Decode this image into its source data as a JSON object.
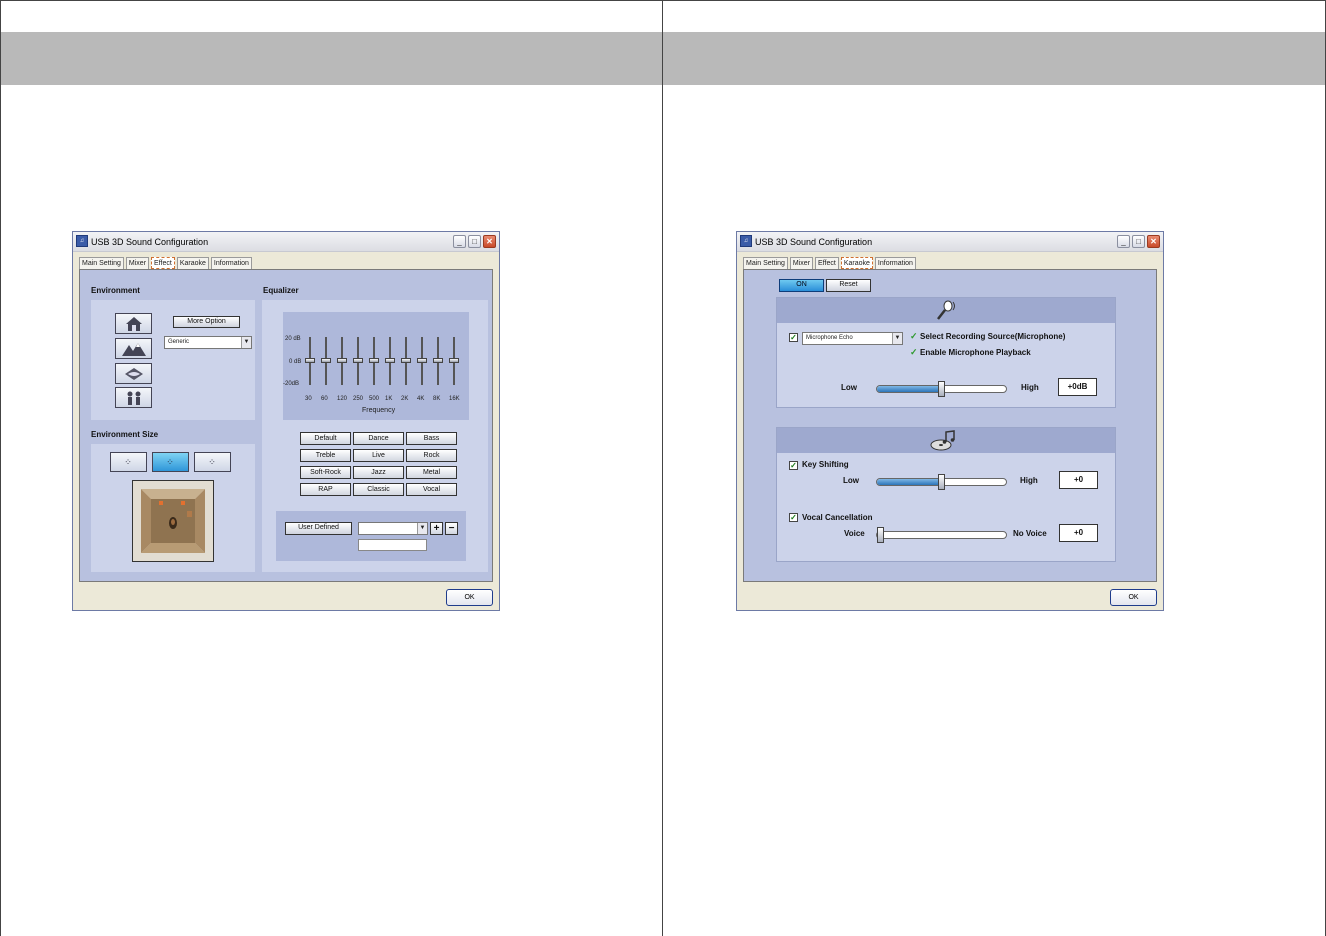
{
  "left_window": {
    "title": "USB 3D Sound Configuration",
    "tabs": [
      "Main Setting",
      "Mixer",
      "Effect",
      "Karaoke",
      "Information"
    ],
    "active_tab": "Effect",
    "environment": {
      "label": "Environment",
      "more_option": "More Option",
      "selected_preset": "Generic",
      "icons": [
        "house-icon",
        "mountains-icon",
        "underwater-icon",
        "people-icon"
      ]
    },
    "environment_size": {
      "label": "Environment Size",
      "buttons": [
        "small-room",
        "medium-room",
        "large-room"
      ],
      "selected": "medium-room"
    },
    "equalizer": {
      "label": "Equalizer",
      "db_labels": [
        "20 dB",
        "0 dB",
        "-20dB"
      ],
      "frequencies": [
        "30",
        "60",
        "120",
        "250",
        "500",
        "1K",
        "2K",
        "4K",
        "8K",
        "16K"
      ],
      "band_levels_db": [
        0,
        0,
        0,
        0,
        0,
        0,
        0,
        0,
        0,
        0
      ],
      "frequency_label": "Frequency",
      "presets": [
        "Default",
        "Dance",
        "Bass",
        "Treble",
        "Live",
        "Rock",
        "Soft-Rock",
        "Jazz",
        "Metal",
        "RAP",
        "Classic",
        "Vocal"
      ],
      "user_defined": "User  Defined",
      "plus": "+",
      "minus": "−"
    },
    "ok": "OK"
  },
  "right_window": {
    "title": "USB 3D Sound Configuration",
    "tabs": [
      "Main Setting",
      "Mixer",
      "Effect",
      "Karaoke",
      "Information"
    ],
    "active_tab": "Karaoke",
    "on": "ON",
    "reset": "Reset",
    "mic": {
      "echo_select": "Microphone Echo",
      "select_recording": "Select Recording Source(Microphone)",
      "enable_playback": "Enable Microphone Playback",
      "low": "Low",
      "high": "High",
      "value": "+0dB",
      "level": 0.5
    },
    "key_shifting": {
      "label": "Key Shifting",
      "low": "Low",
      "high": "High",
      "value": "+0",
      "level": 0.5
    },
    "vocal_cancellation": {
      "label": "Vocal Cancellation",
      "voice": "Voice",
      "no_voice": "No Voice",
      "value": "+0",
      "level": 0
    },
    "ok": "OK"
  },
  "colors": {
    "band": "#b9b9b9",
    "client": "#b8c1df",
    "panel": "#ccd3ea",
    "selected_blue": "#2f96d9"
  }
}
